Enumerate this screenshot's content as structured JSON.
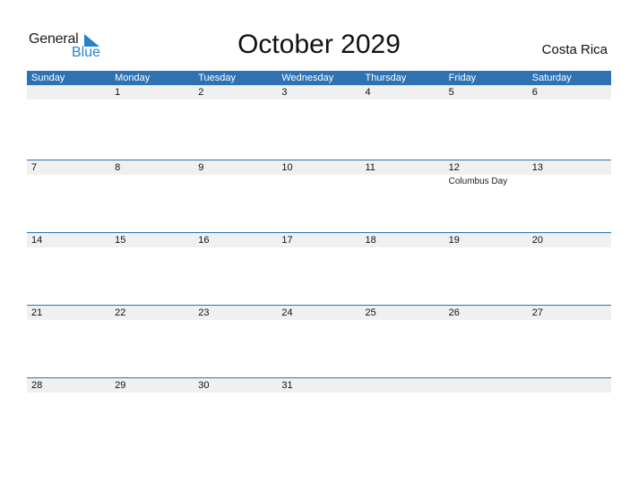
{
  "logo": {
    "word1": "General",
    "word2": "Blue"
  },
  "title": "October 2029",
  "country": "Costa Rica",
  "colors": {
    "header_bg": "#2e72b4",
    "strip_bg": "#f0f0f0",
    "logo_blue": "#2a7fc9"
  },
  "weekdays": [
    "Sunday",
    "Monday",
    "Tuesday",
    "Wednesday",
    "Thursday",
    "Friday",
    "Saturday"
  ],
  "weeks": [
    {
      "days": [
        "",
        "1",
        "2",
        "3",
        "4",
        "5",
        "6"
      ],
      "events": [
        "",
        "",
        "",
        "",
        "",
        "",
        ""
      ]
    },
    {
      "days": [
        "7",
        "8",
        "9",
        "10",
        "11",
        "12",
        "13"
      ],
      "events": [
        "",
        "",
        "",
        "",
        "",
        "Columbus Day",
        ""
      ]
    },
    {
      "days": [
        "14",
        "15",
        "16",
        "17",
        "18",
        "19",
        "20"
      ],
      "events": [
        "",
        "",
        "",
        "",
        "",
        "",
        ""
      ]
    },
    {
      "days": [
        "21",
        "22",
        "23",
        "24",
        "25",
        "26",
        "27"
      ],
      "events": [
        "",
        "",
        "",
        "",
        "",
        "",
        ""
      ]
    },
    {
      "days": [
        "28",
        "29",
        "30",
        "31",
        "",
        "",
        ""
      ],
      "events": [
        "",
        "",
        "",
        "",
        "",
        "",
        ""
      ]
    }
  ]
}
